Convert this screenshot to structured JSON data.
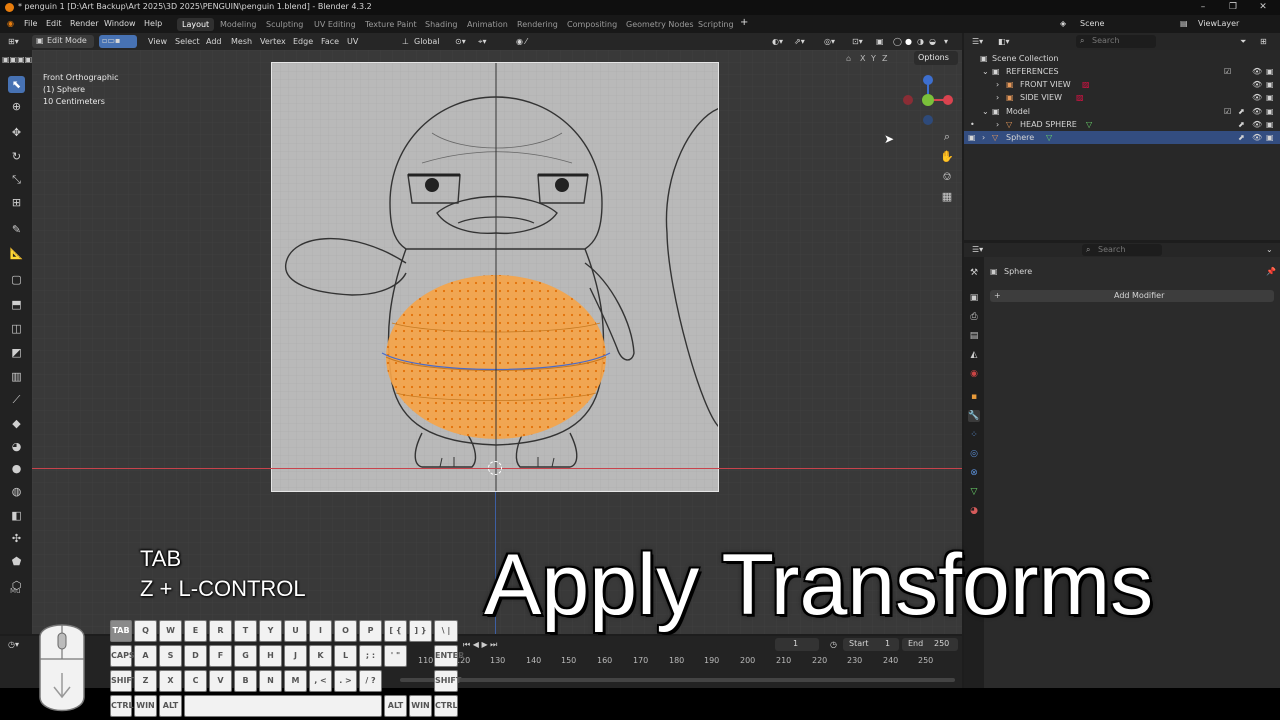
{
  "window": {
    "title": "* penguin 1 [D:\\Art Backup\\Art 2025\\3D 2025\\PENGUIN\\penguin 1.blend] - Blender 4.3.2"
  },
  "menu": [
    "File",
    "Edit",
    "Render",
    "Window",
    "Help"
  ],
  "workspaces": [
    "Layout",
    "Modeling",
    "Sculpting",
    "UV Editing",
    "Texture Paint",
    "Shading",
    "Animation",
    "Rendering",
    "Compositing",
    "Geometry Nodes",
    "Scripting"
  ],
  "scene": {
    "scene_name": "Scene",
    "view_layer": "ViewLayer"
  },
  "viewport_header": {
    "mode": "Edit Mode",
    "menus": [
      "View",
      "Select",
      "Add",
      "Mesh",
      "Vertex",
      "Edge",
      "Face",
      "UV"
    ],
    "orientation": "Global",
    "options_label": "Options",
    "axes": [
      "X",
      "Y",
      "Z"
    ]
  },
  "viewport_overlay": {
    "view_name": "Front Orthographic",
    "object_label": "(1) Sphere",
    "scale_label": "10 Centimeters"
  },
  "outliner": {
    "search_placeholder": "Search",
    "items": [
      {
        "label": "Scene Collection"
      },
      {
        "label": "REFERENCES"
      },
      {
        "label": "FRONT VIEW"
      },
      {
        "label": "SIDE VIEW"
      },
      {
        "label": "Model"
      },
      {
        "label": "HEAD SPHERE"
      },
      {
        "label": "Sphere"
      }
    ]
  },
  "properties": {
    "search_placeholder": "Search",
    "object_name": "Sphere",
    "add_modifier_label": "Add Modifier"
  },
  "timeline": {
    "current_frame": "1",
    "start_label": "Start",
    "start_value": "1",
    "end_label": "End",
    "end_value": "250",
    "ticks": [
      "110",
      "120",
      "130",
      "140",
      "150",
      "160",
      "170",
      "180",
      "190",
      "200",
      "210",
      "220",
      "230",
      "240",
      "250"
    ]
  },
  "tools_footer": {
    "label": "Mu"
  },
  "key_overlay": {
    "line1": "TAB",
    "line2": "Z + L-CONTROL"
  },
  "video_title": "Apply Transforms",
  "keyboard": {
    "row1": [
      "TAB",
      "Q",
      "W",
      "E",
      "R",
      "T",
      "Y",
      "U",
      "I",
      "O",
      "P",
      "[ {",
      "] }",
      "\\ |"
    ],
    "row2": [
      "CAPS",
      "A",
      "S",
      "D",
      "F",
      "G",
      "H",
      "J",
      "K",
      "L",
      ";  :",
      "'  \"",
      "ENTER"
    ],
    "row3": [
      "SHIFT",
      "Z",
      "X",
      "C",
      "V",
      "B",
      "N",
      "M",
      ",  <",
      ".  >",
      "/ ?",
      "SHIFT"
    ],
    "row4": [
      "CTRL",
      "WIN",
      "ALT",
      "",
      "ALT",
      "WIN",
      "CTRL"
    ]
  },
  "colors": {
    "accent": "#4772b3",
    "selection_orange": "#f5a449",
    "outliner_sel": "#334d80"
  }
}
